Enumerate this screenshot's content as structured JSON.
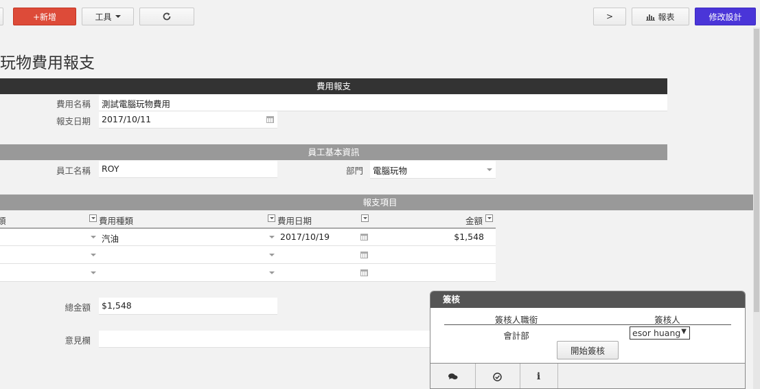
{
  "toolbar": {
    "add_label": "+新增",
    "tools_label": "工具",
    "refresh_icon": "refresh-icon",
    "next_label": ">",
    "report_label": "報表",
    "modify_label": "修改設計"
  },
  "page": {
    "title": "玩物費用報支"
  },
  "expense": {
    "header": "費用報支",
    "name_label": "費用名稱",
    "name_value": "測試電腦玩物費用",
    "date_label": "報支日期",
    "date_value": "2017/10/11"
  },
  "employee": {
    "header": "員工基本資訊",
    "name_label": "員工名稱",
    "name_value": "ROY",
    "dept_label": "部門",
    "dept_value": "電腦玩物"
  },
  "items": {
    "header": "報支項目",
    "columns": [
      "類",
      "費用種類",
      "費用日期",
      "金額"
    ],
    "rows": [
      {
        "type": "汽油",
        "date": "2017/10/19",
        "amount": "$1,548"
      },
      {
        "type": "",
        "date": "",
        "amount": ""
      },
      {
        "type": "",
        "date": "",
        "amount": ""
      }
    ]
  },
  "summary": {
    "total_label": "總金額",
    "total_value": "$1,548",
    "comment_label": "意見欄"
  },
  "sign": {
    "title": "簽核",
    "col_title": "簽核人職銜",
    "col_person": "簽核人",
    "role": "會計部",
    "person": "esor huang",
    "start_label": "開始簽核"
  },
  "colors": {
    "add": "#dd4b39",
    "modify": "#4a35d8",
    "bar_dark": "#333333",
    "bar_gray": "#999999"
  }
}
